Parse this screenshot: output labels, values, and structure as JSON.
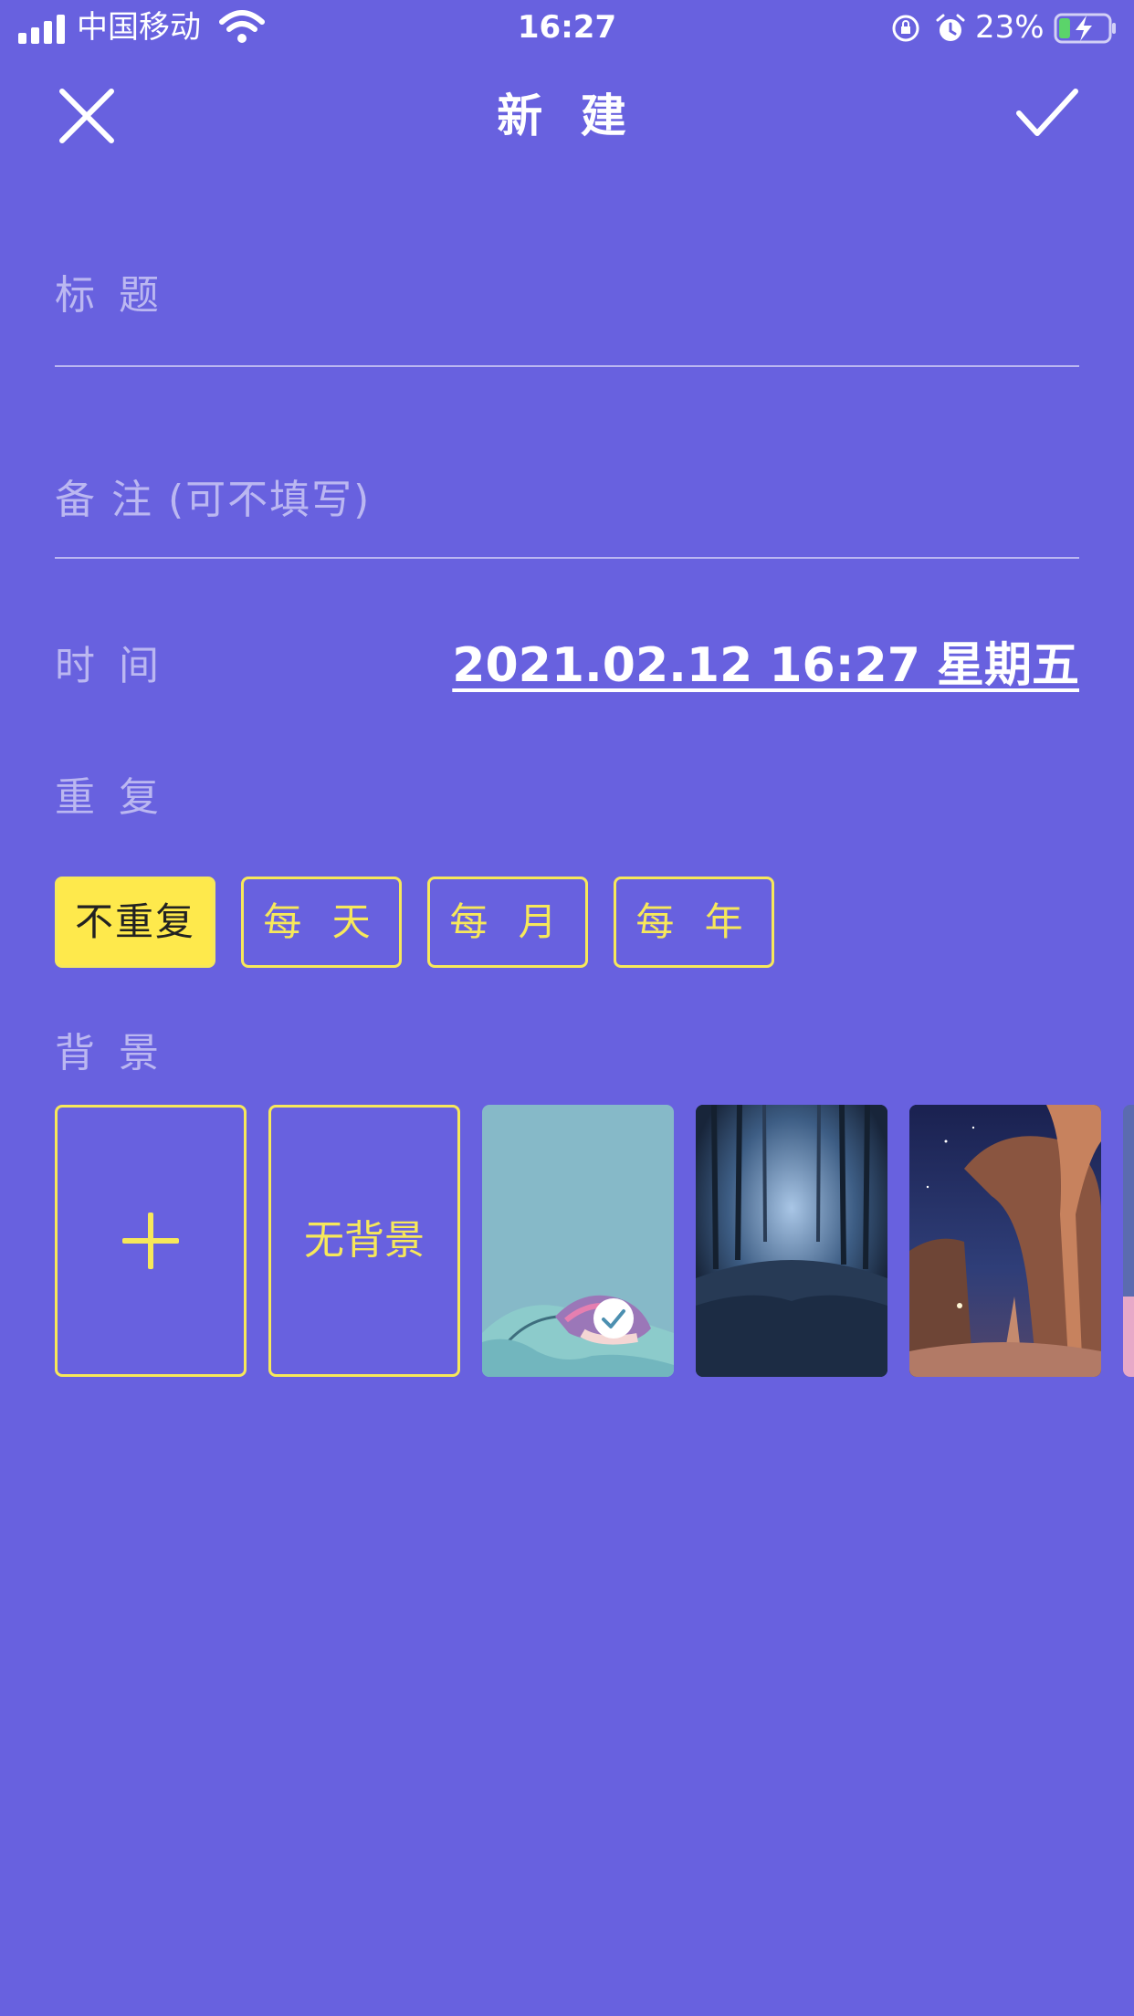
{
  "status_bar": {
    "carrier": "中国移动",
    "time": "16:27",
    "battery_percent": "23%",
    "battery_level": 0.23
  },
  "header": {
    "title": "新 建",
    "close_icon": "close-icon",
    "confirm_icon": "checkmark-icon"
  },
  "form": {
    "title_placeholder": "标 题",
    "note_placeholder": "备 注 (可不填写)",
    "time_label": "时 间",
    "time_value": "2021.02.12 16:27 星期五",
    "repeat_label": "重 复",
    "repeat_options": [
      "不重复",
      "每 天",
      "每 月",
      "每 年"
    ],
    "repeat_selected": "不重复",
    "background_label": "背 景",
    "background_none": "无背景"
  },
  "colors": {
    "background": "#6861DF",
    "accent_yellow": "#FEE94C",
    "text": "#FFFFFF"
  }
}
